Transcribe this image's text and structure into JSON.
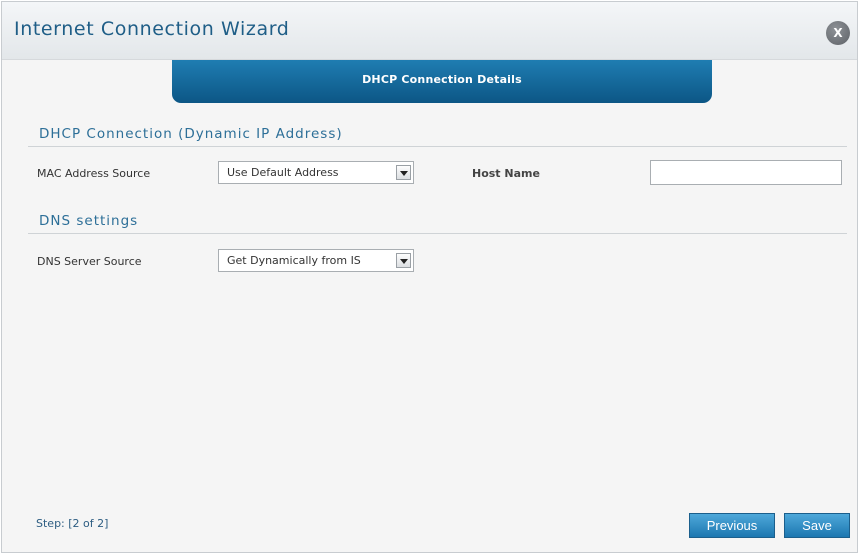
{
  "window": {
    "title": "Internet Connection Wizard",
    "close_label": "X"
  },
  "banner": {
    "label": "DHCP Connection Details"
  },
  "dhcp": {
    "section_title": "DHCP Connection (Dynamic IP Address)",
    "mac_label": "MAC Address Source",
    "mac_value": "Use Default Address",
    "host_label": "Host Name",
    "host_value": ""
  },
  "dns": {
    "section_title": "DNS settings",
    "server_label": "DNS Server Source",
    "server_value": "Get Dynamically from IS"
  },
  "footer": {
    "step_text": "Step: [2 of 2]",
    "previous_label": "Previous",
    "save_label": "Save"
  }
}
